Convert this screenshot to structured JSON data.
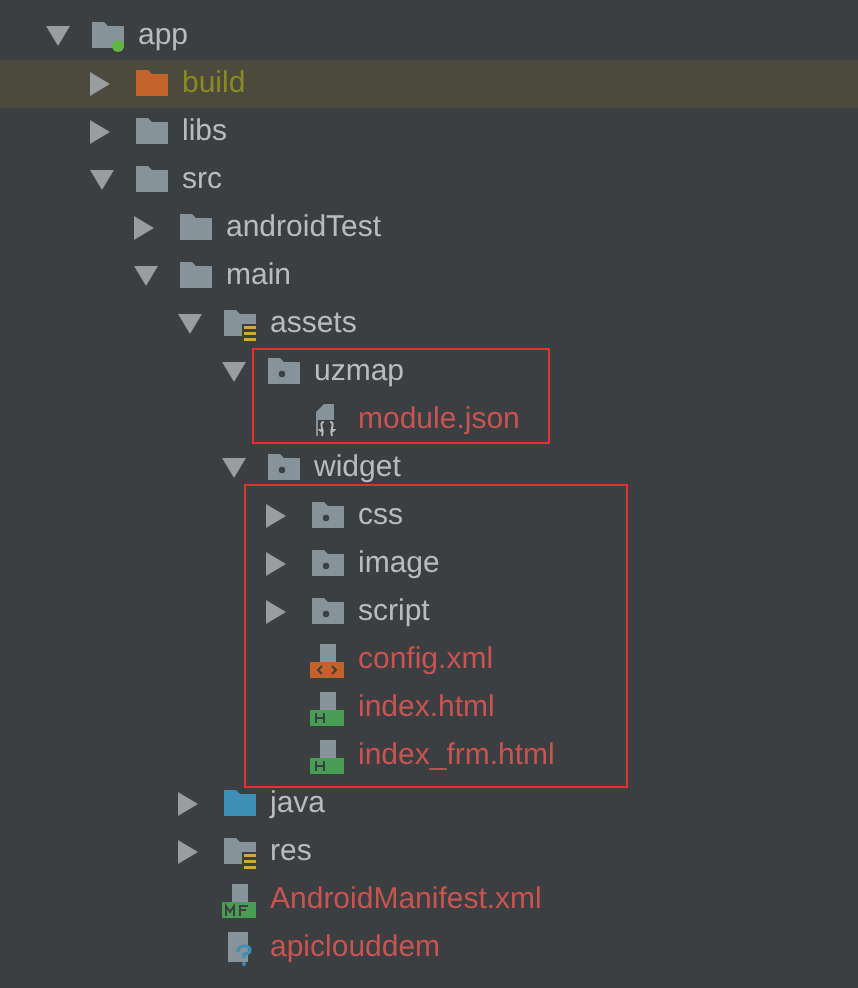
{
  "tree": [
    {
      "name": "app",
      "kind": "module-folder",
      "expanded": true,
      "selected": false,
      "color": "#bbbbbb",
      "children": [
        {
          "name": "build",
          "kind": "excluded-folder",
          "expanded": false,
          "selected": true,
          "color": "#8a8a24"
        },
        {
          "name": "libs",
          "kind": "folder",
          "expanded": false,
          "selected": false,
          "color": "#bbbbbb"
        },
        {
          "name": "src",
          "kind": "folder",
          "expanded": true,
          "selected": false,
          "color": "#bbbbbb",
          "children": [
            {
              "name": "androidTest",
              "kind": "folder",
              "expanded": false,
              "selected": false,
              "color": "#bbbbbb"
            },
            {
              "name": "main",
              "kind": "folder",
              "expanded": true,
              "selected": false,
              "color": "#bbbbbb",
              "children": [
                {
                  "name": "assets",
                  "kind": "resource-folder",
                  "expanded": true,
                  "selected": false,
                  "color": "#bbbbbb",
                  "children": [
                    {
                      "name": "uzmap",
                      "kind": "package-folder",
                      "expanded": true,
                      "selected": false,
                      "color": "#bbbbbb",
                      "framed": true,
                      "children": [
                        {
                          "name": "module.json",
                          "kind": "json-file",
                          "selected": false,
                          "color": "#c75450"
                        }
                      ]
                    },
                    {
                      "name": "widget",
                      "kind": "package-folder",
                      "expanded": true,
                      "selected": false,
                      "color": "#bbbbbb",
                      "children_framed": true,
                      "children": [
                        {
                          "name": "css",
                          "kind": "package-folder",
                          "expanded": false,
                          "selected": false,
                          "color": "#bbbbbb"
                        },
                        {
                          "name": "image",
                          "kind": "package-folder",
                          "expanded": false,
                          "selected": false,
                          "color": "#bbbbbb"
                        },
                        {
                          "name": "script",
                          "kind": "package-folder",
                          "expanded": false,
                          "selected": false,
                          "color": "#bbbbbb"
                        },
                        {
                          "name": "config.xml",
                          "kind": "xml-file",
                          "selected": false,
                          "color": "#c75450"
                        },
                        {
                          "name": "index.html",
                          "kind": "html-file",
                          "selected": false,
                          "color": "#c75450"
                        },
                        {
                          "name": "index_frm.html",
                          "kind": "html-file",
                          "selected": false,
                          "color": "#c75450"
                        }
                      ]
                    }
                  ]
                },
                {
                  "name": "java",
                  "kind": "source-folder",
                  "expanded": false,
                  "selected": false,
                  "color": "#bbbbbb"
                },
                {
                  "name": "res",
                  "kind": "resource-folder",
                  "expanded": false,
                  "selected": false,
                  "color": "#bbbbbb"
                },
                {
                  "name": "AndroidManifest.xml",
                  "kind": "manifest-file",
                  "selected": false,
                  "color": "#c75450"
                },
                {
                  "name": "apiclouddem",
                  "kind": "unknown-file",
                  "selected": false,
                  "color": "#c75450"
                }
              ]
            }
          ]
        }
      ]
    }
  ]
}
